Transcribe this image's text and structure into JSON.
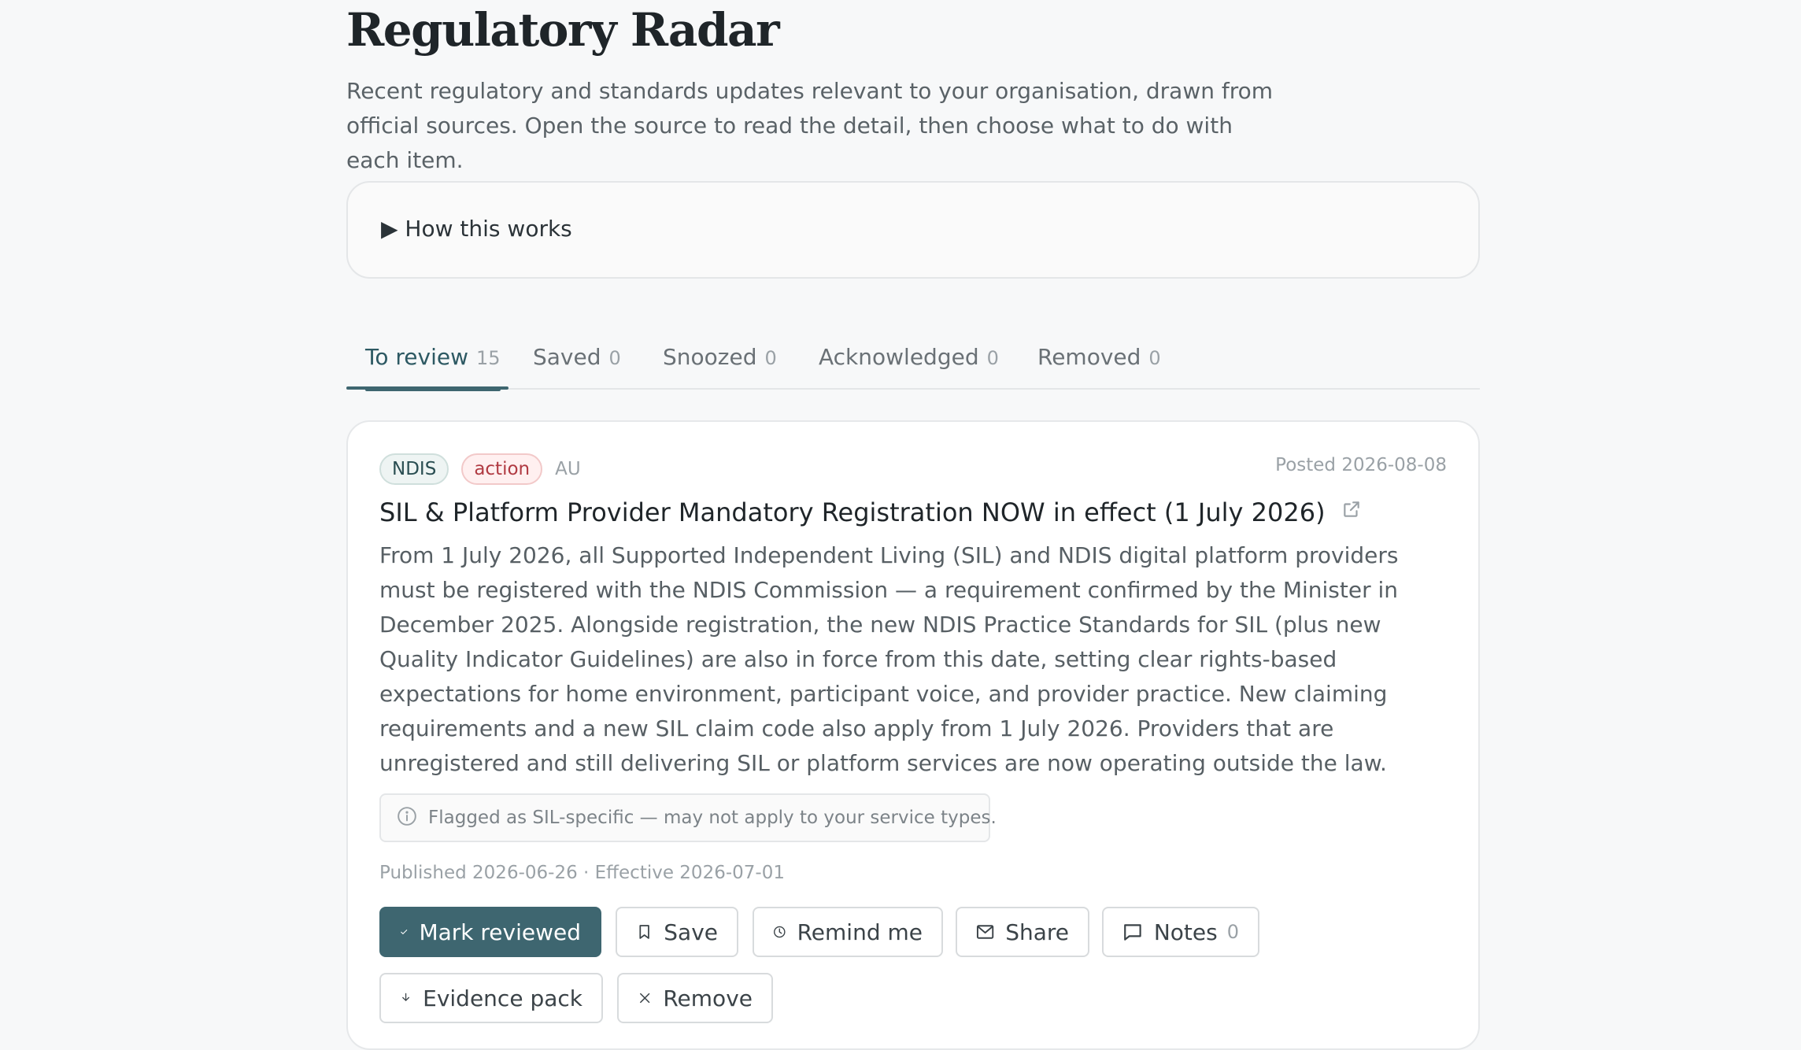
{
  "page": {
    "title": "Regulatory Radar",
    "intro": "Recent regulatory and standards updates relevant to your organisation, drawn from official sources. Open the source to read the detail, then choose what to do with each item."
  },
  "how_it_works": {
    "label": "▶ How this works"
  },
  "tabs": [
    {
      "label": "To review",
      "count": "15",
      "active": true
    },
    {
      "label": "Saved",
      "count": "0",
      "active": false
    },
    {
      "label": "Snoozed",
      "count": "0",
      "active": false
    },
    {
      "label": "Acknowledged",
      "count": "0",
      "active": false
    },
    {
      "label": "Removed",
      "count": "0",
      "active": false
    }
  ],
  "item": {
    "badges": {
      "program": "NDIS",
      "type": "action",
      "region": "AU"
    },
    "posted": "Posted 2026-08-08",
    "title": "SIL & Platform Provider Mandatory Registration NOW in effect (1 July 2026)",
    "body": "From 1 July 2026, all Supported Independent Living (SIL) and NDIS digital platform providers must be registered with the NDIS Commission — a requirement confirmed by the Minister in December 2025. Alongside registration, the new NDIS Practice Standards for SIL (plus new Quality Indicator Guidelines) are also in force from this date, setting clear rights-based expectations for home environment, participant voice, and provider practice. New claiming requirements and a new SIL claim code also apply from 1 July 2026. Providers that are unregistered and still delivering SIL or platform services are now operating outside the law.",
    "flag": "Flagged as SIL-specific — may not apply to your service types.",
    "dates": "Published 2026-06-26 · Effective 2026-07-01",
    "actions": {
      "mark_reviewed": "Mark reviewed",
      "save": "Save",
      "remind": "Remind me",
      "share": "Share",
      "notes": "Notes",
      "notes_count": "0",
      "evidence": "Evidence pack",
      "remove": "Remove"
    }
  },
  "colors": {
    "accent": "#3e6670",
    "action_badge": "#b03a42",
    "ndis_badge": "#2a4e52"
  }
}
